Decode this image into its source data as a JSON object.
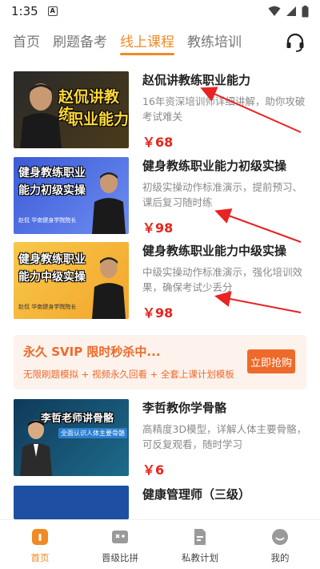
{
  "status_bar": {
    "time": "1:35",
    "badge": "A"
  },
  "tabs": [
    {
      "label": "首页"
    },
    {
      "label": "刷题备考"
    },
    {
      "label": "线上课程"
    },
    {
      "label": "教练培训"
    }
  ],
  "active_tab_index": 2,
  "courses": [
    {
      "title": "赵侃讲教练职业能力",
      "desc": "16年资深培训师详细讲解，助你攻破考试难关",
      "price": "￥68",
      "thumb_text": [
        "赵侃讲教练",
        "职业能力"
      ]
    },
    {
      "title": "健身教练职业能力初级实操",
      "desc": "初级实操动作标准演示，提前预习、课后复习随时练",
      "price": "￥98",
      "thumb_text": [
        "健身教练职业",
        "能力初级实操"
      ],
      "thumb_caption": "赵侃   华南健身学院院长"
    },
    {
      "title": "健身教练职业能力中级实操",
      "desc": "中级实操动作标准演示，强化培训效果，确保考试少丢分",
      "price": "￥98",
      "thumb_text": [
        "健身教练职业",
        "能力中级实操"
      ],
      "thumb_caption": "赵侃   华南健身学院院长"
    },
    {
      "title": "李哲教你学骨骼",
      "desc": "高精度3D模型，详解人体主要骨骼，可反复观看，随时学习",
      "price": "￥6",
      "thumb_text": [
        "李哲老师讲骨骼"
      ],
      "thumb_sub": "全面认识人体主要骨骼"
    },
    {
      "title": "健康管理师（三级）",
      "desc": "",
      "price": ""
    }
  ],
  "promo": {
    "title": "永久 SVIP 限时秒杀中...",
    "subtitle": "无限刷题模拟 + 视频永久回看 + 全套上课计划模板",
    "button": "立即抢购"
  },
  "bottom_nav": [
    {
      "label": "首页",
      "icon": "home-icon"
    },
    {
      "label": "晋级比拼",
      "icon": "gamepad-icon"
    },
    {
      "label": "私教计划",
      "icon": "document-icon"
    },
    {
      "label": "我的",
      "icon": "profile-icon"
    }
  ],
  "colors": {
    "accent": "#f08a24",
    "price": "#e8231a",
    "promo": "#ee6a2a",
    "arrow": "#e82323"
  }
}
